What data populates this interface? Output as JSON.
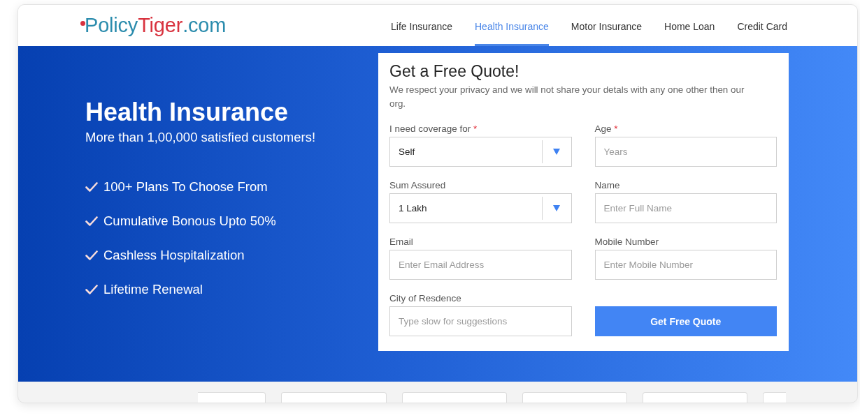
{
  "header": {
    "logo": {
      "prefix": "Policy",
      "highlight": "Tiger",
      "suffix": ".com"
    },
    "nav": [
      {
        "label": "Life Insurance",
        "selected": false
      },
      {
        "label": "Health Insurance",
        "selected": true
      },
      {
        "label": "Motor Insurance",
        "selected": false
      },
      {
        "label": "Home Loan",
        "selected": false
      },
      {
        "label": "Credit Card",
        "selected": false
      }
    ]
  },
  "hero": {
    "title": "Health Insurance",
    "subtitle": "More than 1,00,000 satisfied customers!",
    "features": [
      "100+ Plans To Choose From",
      "Cumulative Bonous Upto 50%",
      "Cashless Hospitalization",
      "Lifetime Renewal"
    ]
  },
  "quote_form": {
    "title": "Get a Free Quote!",
    "description": "We respect your privacy and we will not share your detals with any one other then our org.",
    "fields": [
      {
        "kind": "select",
        "label": "I need coverage for",
        "required_mark": "*",
        "value": "Self"
      },
      {
        "kind": "input",
        "label": "Age",
        "required_mark": "*",
        "placeholder": "Years"
      },
      {
        "kind": "select",
        "label": "Sum Assured",
        "value": "1 Lakh"
      },
      {
        "kind": "input",
        "label": "Name",
        "placeholder": "Enter Full Name"
      },
      {
        "kind": "input",
        "label": "Email",
        "placeholder": "Enter Email Address"
      },
      {
        "kind": "input",
        "label": "Mobile Number",
        "placeholder": "Enter Mobile Number"
      },
      {
        "kind": "input",
        "label": "City of Resdence",
        "placeholder": "Type slow for suggestions"
      }
    ],
    "submit": "Get Free Quote"
  }
}
